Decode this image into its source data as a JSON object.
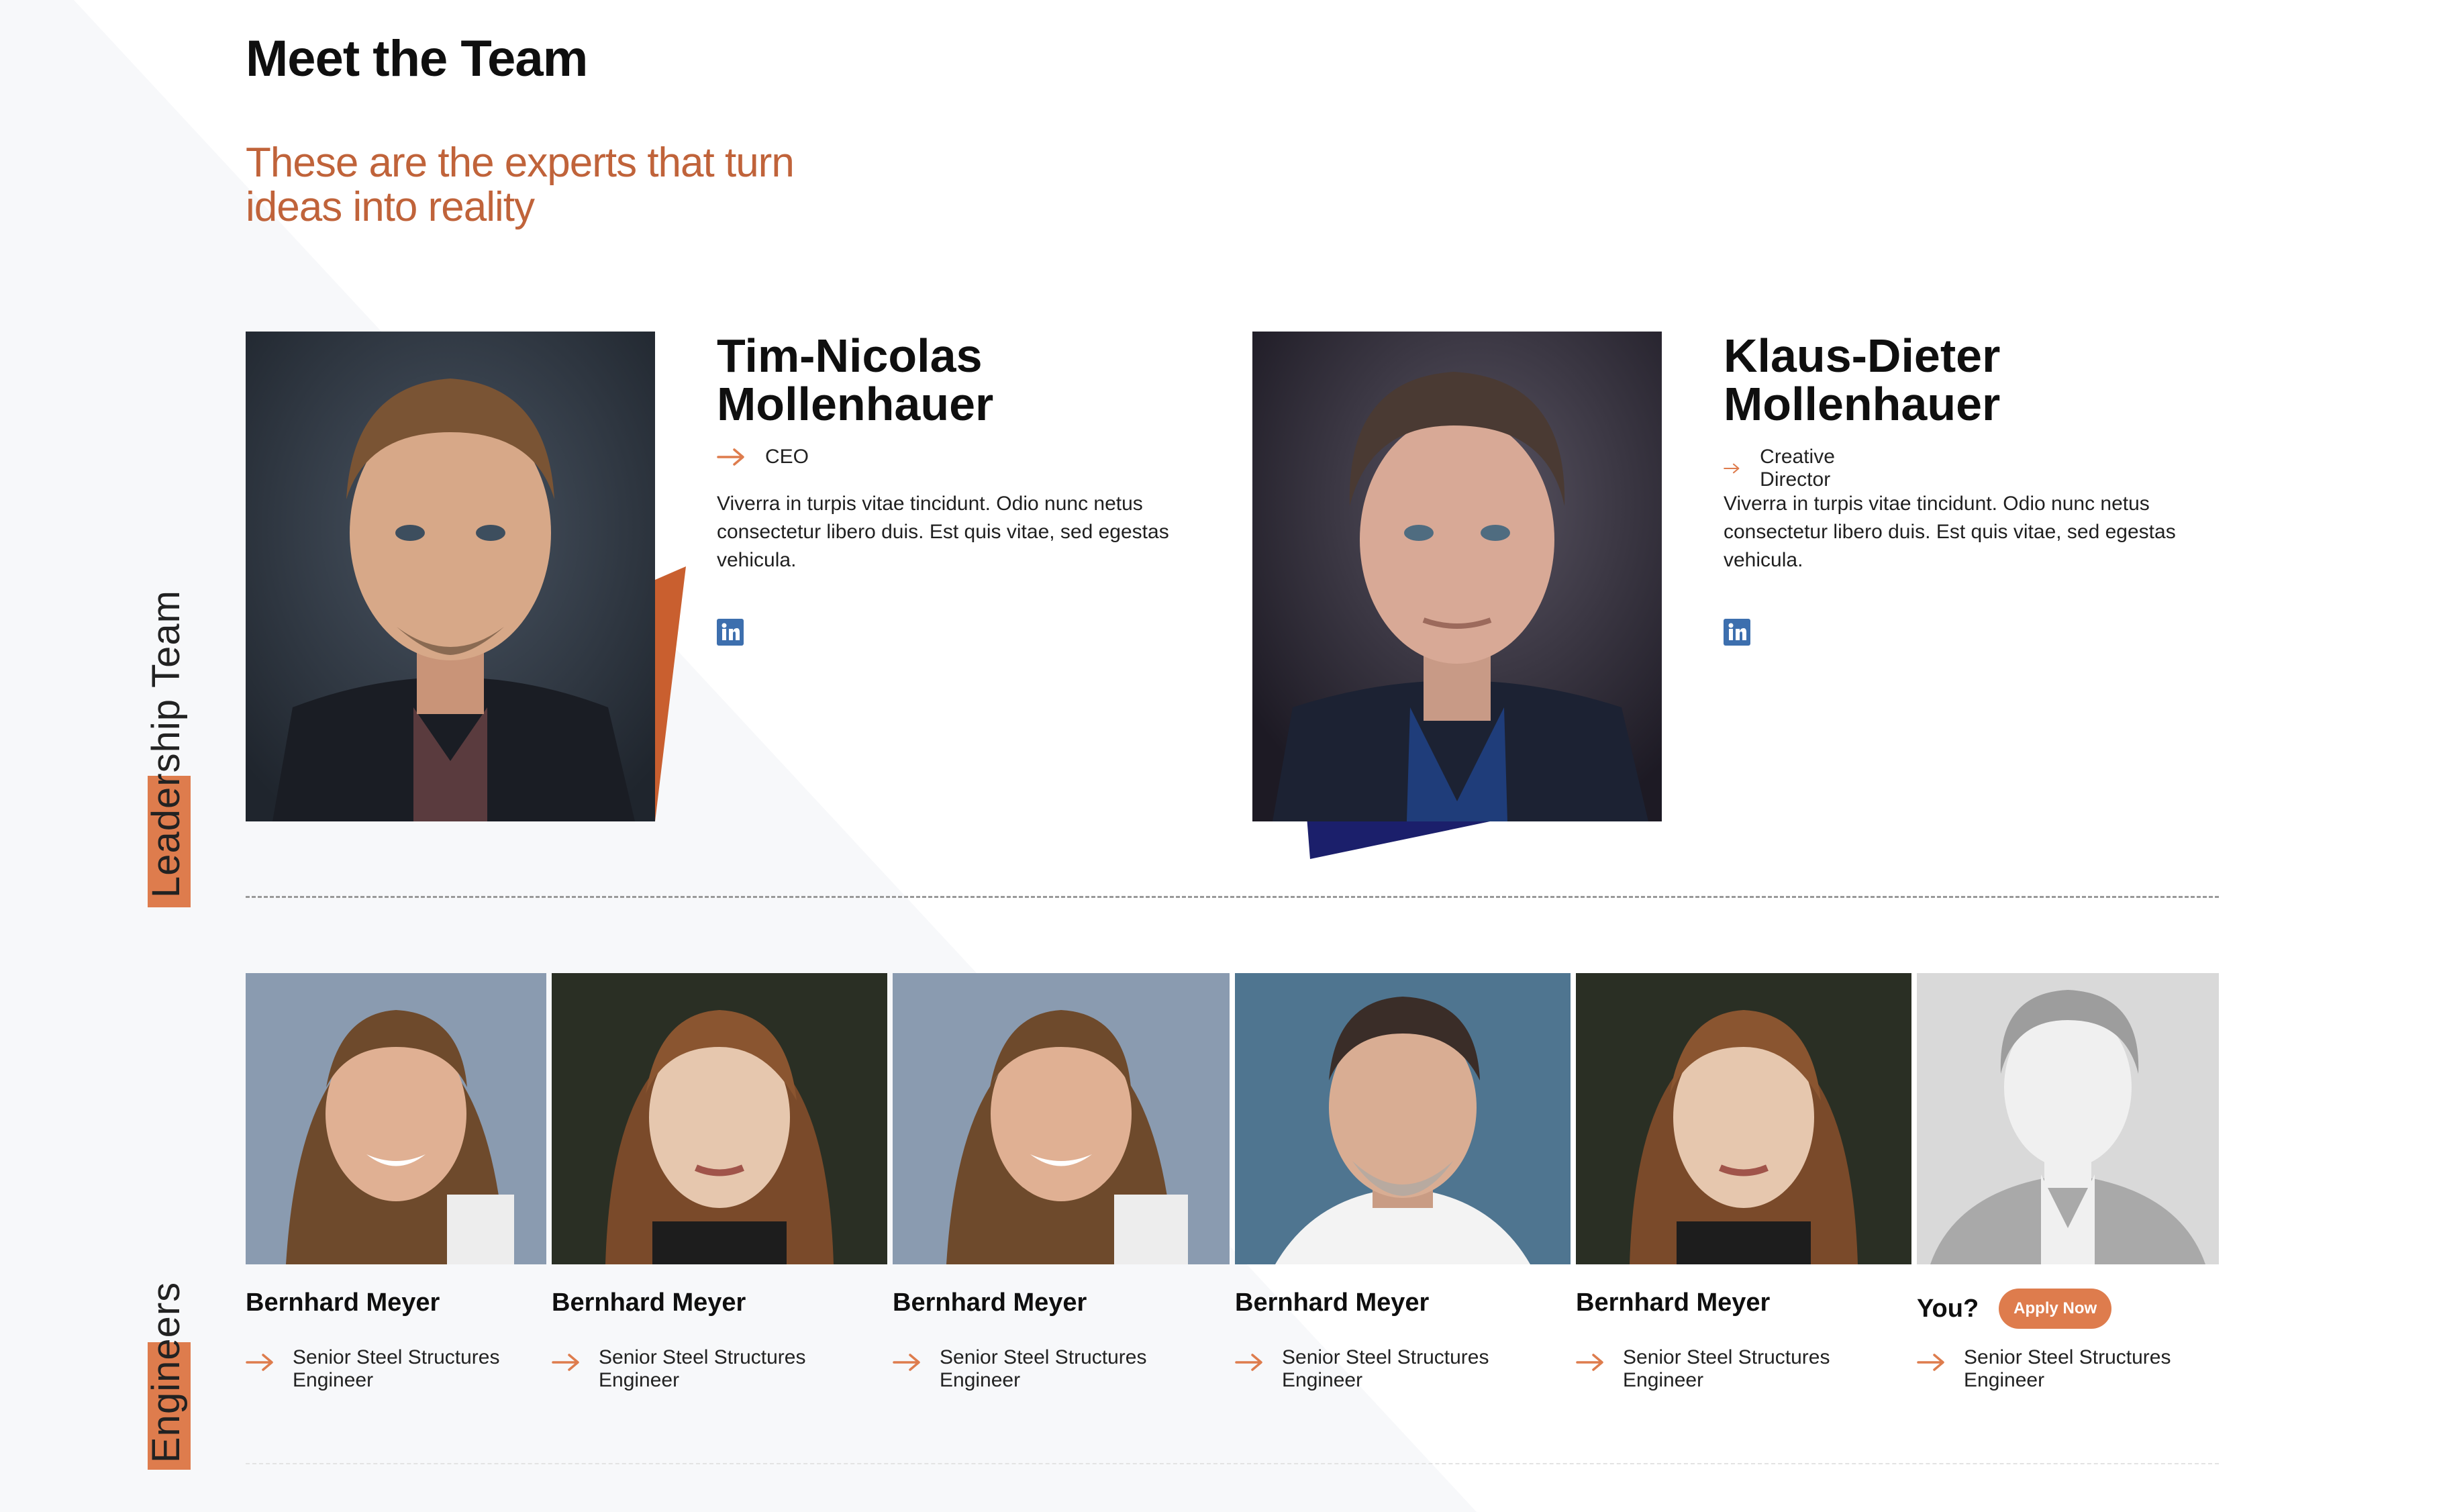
{
  "header": {
    "title": "Meet the Team",
    "subtitle": "These are the experts that turn ideas into reality"
  },
  "sections": {
    "leadership_label": "Leadership Team",
    "engineers_label": "Engineers"
  },
  "leaders": [
    {
      "name": "Tim-Nicolas Mollenhauer",
      "role": "CEO",
      "description": "Viverra in turpis vitae tincidunt. Odio nunc netus consectetur libero duis. Est quis vitae, sed egestas vehicula.",
      "social": "linkedin-icon"
    },
    {
      "name": "Klaus-Dieter Mollenhauer",
      "role": "Creative Director",
      "description": "Viverra in turpis vitae tincidunt. Odio nunc netus consectetur libero duis. Est quis vitae, sed egestas vehicula.",
      "social": "linkedin-icon"
    }
  ],
  "engineers": [
    {
      "name": "Bernhard Meyer",
      "role": "Senior Steel Structures Engineer"
    },
    {
      "name": "Bernhard Meyer",
      "role": "Senior Steel Structures Engineer"
    },
    {
      "name": "Bernhard Meyer",
      "role": "Senior Steel Structures Engineer"
    },
    {
      "name": "Bernhard Meyer",
      "role": "Senior Steel Structures Engineer"
    },
    {
      "name": "Bernhard Meyer",
      "role": "Senior Steel Structures Engineer"
    },
    {
      "name": "You?",
      "role": "Senior Steel Structures Engineer",
      "cta": "Apply Now"
    }
  ],
  "colors": {
    "accent": "#de7c4d",
    "subtitle": "#c0633a",
    "navy": "#1b1f6b",
    "linkedin": "#3d6fae",
    "background_tint": "#f7f8fa"
  }
}
